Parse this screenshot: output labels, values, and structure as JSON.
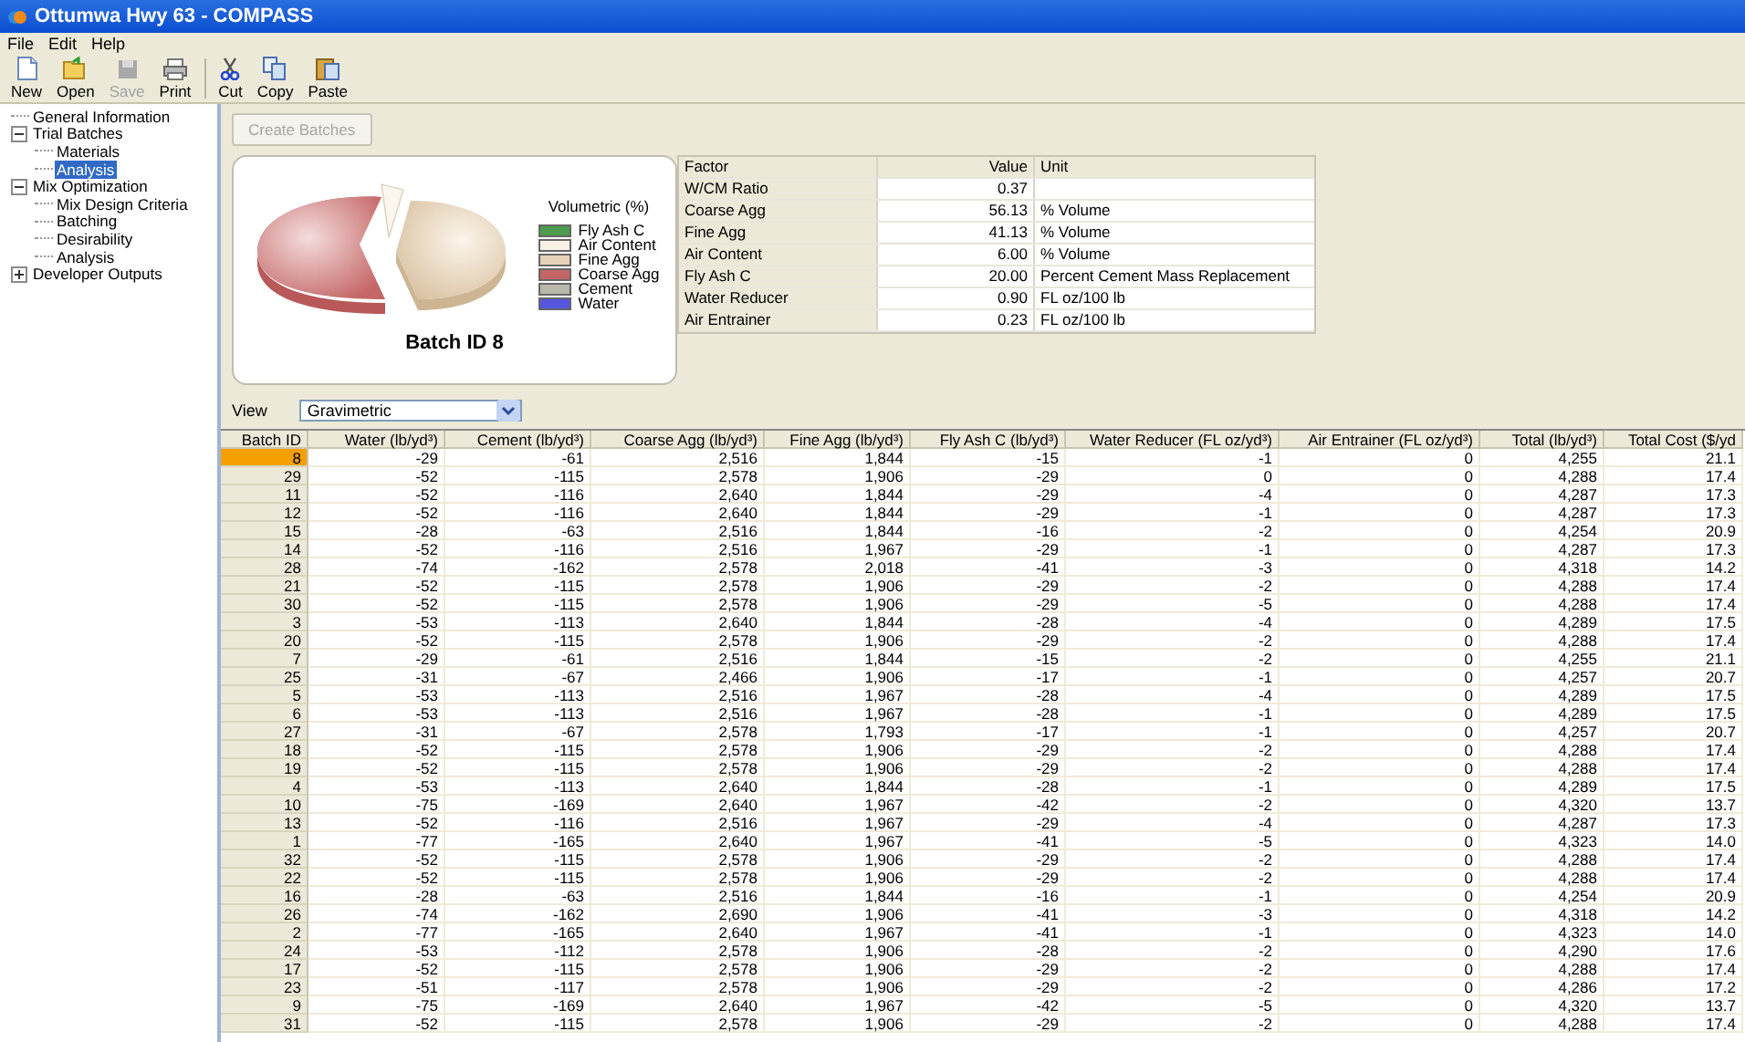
{
  "window": {
    "title": "Ottumwa Hwy 63 - COMPASS"
  },
  "menu": [
    "File",
    "Edit",
    "Help"
  ],
  "toolbar": [
    {
      "label": "New",
      "kind": "new",
      "disabled": false
    },
    {
      "label": "Open",
      "kind": "open",
      "disabled": false
    },
    {
      "label": "Save",
      "kind": "save",
      "disabled": true
    },
    {
      "label": "Print",
      "kind": "print",
      "disabled": false
    },
    {
      "label": "Cut",
      "kind": "cut",
      "disabled": false,
      "group_start": true
    },
    {
      "label": "Copy",
      "kind": "copy",
      "disabled": false
    },
    {
      "label": "Paste",
      "kind": "paste",
      "disabled": false
    }
  ],
  "sidebar": {
    "items": [
      {
        "label": "General Information",
        "selected": false
      },
      {
        "label": "Trial Batches",
        "selected": false,
        "expanded": true,
        "children": [
          {
            "label": "Materials",
            "selected": false
          },
          {
            "label": "Analysis",
            "selected": true
          }
        ]
      },
      {
        "label": "Mix Optimization",
        "selected": false,
        "expanded": true,
        "children": [
          {
            "label": "Mix Design Criteria",
            "selected": false
          },
          {
            "label": "Batching",
            "selected": false
          },
          {
            "label": "Desirability",
            "selected": false
          },
          {
            "label": "Analysis",
            "selected": false
          }
        ]
      },
      {
        "label": "Developer Outputs",
        "selected": false,
        "expanded": false
      }
    ]
  },
  "create_button": {
    "label": "Create Batches",
    "disabled": true
  },
  "chart_card": {
    "legend_title": "Volumetric (%)",
    "caption": "Batch ID 8",
    "legend": [
      {
        "label": "Fly Ash C",
        "color": "#4e9a4e"
      },
      {
        "label": "Air Content",
        "color": "#f8f2e6"
      },
      {
        "label": "Fine Agg",
        "color": "#e6d2b6"
      },
      {
        "label": "Coarse Agg",
        "color": "#c46666"
      },
      {
        "label": "Cement",
        "color": "#bab6aa"
      },
      {
        "label": "Water",
        "color": "#5656dd"
      }
    ]
  },
  "factors": {
    "columns": [
      "Factor",
      "Value",
      "Unit"
    ],
    "rows": [
      {
        "factor": "W/CM Ratio",
        "value": "0.37"
      },
      {
        "factor": "Coarse Agg",
        "value": "56.13",
        "unit": "% Volume"
      },
      {
        "factor": "Fine Agg",
        "value": "41.13",
        "unit": "% Volume"
      },
      {
        "factor": "Air Content",
        "value": "6.00",
        "unit": "% Volume"
      },
      {
        "factor": "Fly Ash C",
        "value": "20.00",
        "unit": "Percent Cement Mass Replacement"
      },
      {
        "factor": "Water Reducer",
        "value": "0.90",
        "unit": "FL oz/100 lb"
      },
      {
        "factor": "Air Entrainer",
        "value": "0.23",
        "unit": "FL oz/100 lb"
      }
    ]
  },
  "view": {
    "label": "View",
    "value": "Gravimetric"
  },
  "grid": {
    "columns": [
      "Batch ID",
      "Water (lb/yd³)",
      "Cement (lb/yd³)",
      "Coarse Agg (lb/yd³)",
      "Fine Agg (lb/yd³)",
      "Fly Ash C (lb/yd³)",
      "Water Reducer (FL oz/yd³)",
      "Air Entrainer (FL oz/yd³)",
      "Total (lb/yd³)",
      "Total Cost ($/yd"
    ],
    "rows": [
      {
        "selected": true,
        "cells": [
          "8",
          "-29",
          "-61",
          "2,516",
          "1,844",
          "-15",
          "-1",
          "0",
          "4,255",
          "21.1"
        ]
      },
      {
        "selected": false,
        "cells": [
          "29",
          "-52",
          "-115",
          "2,578",
          "1,906",
          "-29",
          "0",
          "0",
          "4,288",
          "17.4"
        ]
      },
      {
        "selected": false,
        "cells": [
          "11",
          "-52",
          "-116",
          "2,640",
          "1,844",
          "-29",
          "-4",
          "0",
          "4,287",
          "17.3"
        ]
      },
      {
        "selected": false,
        "cells": [
          "12",
          "-52",
          "-116",
          "2,640",
          "1,844",
          "-29",
          "-1",
          "0",
          "4,287",
          "17.3"
        ]
      },
      {
        "selected": false,
        "cells": [
          "15",
          "-28",
          "-63",
          "2,516",
          "1,844",
          "-16",
          "-2",
          "0",
          "4,254",
          "20.9"
        ]
      },
      {
        "selected": false,
        "cells": [
          "14",
          "-52",
          "-116",
          "2,516",
          "1,967",
          "-29",
          "-1",
          "0",
          "4,287",
          "17.3"
        ]
      },
      {
        "selected": false,
        "cells": [
          "28",
          "-74",
          "-162",
          "2,578",
          "2,018",
          "-41",
          "-3",
          "0",
          "4,318",
          "14.2"
        ]
      },
      {
        "selected": false,
        "cells": [
          "21",
          "-52",
          "-115",
          "2,578",
          "1,906",
          "-29",
          "-2",
          "0",
          "4,288",
          "17.4"
        ]
      },
      {
        "selected": false,
        "cells": [
          "30",
          "-52",
          "-115",
          "2,578",
          "1,906",
          "-29",
          "-5",
          "0",
          "4,288",
          "17.4"
        ]
      },
      {
        "selected": false,
        "cells": [
          "3",
          "-53",
          "-113",
          "2,640",
          "1,844",
          "-28",
          "-4",
          "0",
          "4,289",
          "17.5"
        ]
      },
      {
        "selected": false,
        "cells": [
          "20",
          "-52",
          "-115",
          "2,578",
          "1,906",
          "-29",
          "-2",
          "0",
          "4,288",
          "17.4"
        ]
      },
      {
        "selected": false,
        "cells": [
          "7",
          "-29",
          "-61",
          "2,516",
          "1,844",
          "-15",
          "-2",
          "0",
          "4,255",
          "21.1"
        ]
      },
      {
        "selected": false,
        "cells": [
          "25",
          "-31",
          "-67",
          "2,466",
          "1,906",
          "-17",
          "-1",
          "0",
          "4,257",
          "20.7"
        ]
      },
      {
        "selected": false,
        "cells": [
          "5",
          "-53",
          "-113",
          "2,516",
          "1,967",
          "-28",
          "-4",
          "0",
          "4,289",
          "17.5"
        ]
      },
      {
        "selected": false,
        "cells": [
          "6",
          "-53",
          "-113",
          "2,516",
          "1,967",
          "-28",
          "-1",
          "0",
          "4,289",
          "17.5"
        ]
      },
      {
        "selected": false,
        "cells": [
          "27",
          "-31",
          "-67",
          "2,578",
          "1,793",
          "-17",
          "-1",
          "0",
          "4,257",
          "20.7"
        ]
      },
      {
        "selected": false,
        "cells": [
          "18",
          "-52",
          "-115",
          "2,578",
          "1,906",
          "-29",
          "-2",
          "0",
          "4,288",
          "17.4"
        ]
      },
      {
        "selected": false,
        "cells": [
          "19",
          "-52",
          "-115",
          "2,578",
          "1,906",
          "-29",
          "-2",
          "0",
          "4,288",
          "17.4"
        ]
      },
      {
        "selected": false,
        "cells": [
          "4",
          "-53",
          "-113",
          "2,640",
          "1,844",
          "-28",
          "-1",
          "0",
          "4,289",
          "17.5"
        ]
      },
      {
        "selected": false,
        "cells": [
          "10",
          "-75",
          "-169",
          "2,640",
          "1,967",
          "-42",
          "-2",
          "0",
          "4,320",
          "13.7"
        ]
      },
      {
        "selected": false,
        "cells": [
          "13",
          "-52",
          "-116",
          "2,516",
          "1,967",
          "-29",
          "-4",
          "0",
          "4,287",
          "17.3"
        ]
      },
      {
        "selected": false,
        "cells": [
          "1",
          "-77",
          "-165",
          "2,640",
          "1,967",
          "-41",
          "-5",
          "0",
          "4,323",
          "14.0"
        ]
      },
      {
        "selected": false,
        "cells": [
          "32",
          "-52",
          "-115",
          "2,578",
          "1,906",
          "-29",
          "-2",
          "0",
          "4,288",
          "17.4"
        ]
      },
      {
        "selected": false,
        "cells": [
          "22",
          "-52",
          "-115",
          "2,578",
          "1,906",
          "-29",
          "-2",
          "0",
          "4,288",
          "17.4"
        ]
      },
      {
        "selected": false,
        "cells": [
          "16",
          "-28",
          "-63",
          "2,516",
          "1,844",
          "-16",
          "-1",
          "0",
          "4,254",
          "20.9"
        ]
      },
      {
        "selected": false,
        "cells": [
          "26",
          "-74",
          "-162",
          "2,690",
          "1,906",
          "-41",
          "-3",
          "0",
          "4,318",
          "14.2"
        ]
      },
      {
        "selected": false,
        "cells": [
          "2",
          "-77",
          "-165",
          "2,640",
          "1,967",
          "-41",
          "-1",
          "0",
          "4,323",
          "14.0"
        ]
      },
      {
        "selected": false,
        "cells": [
          "24",
          "-53",
          "-112",
          "2,578",
          "1,906",
          "-28",
          "-2",
          "0",
          "4,290",
          "17.6"
        ]
      },
      {
        "selected": false,
        "cells": [
          "17",
          "-52",
          "-115",
          "2,578",
          "1,906",
          "-29",
          "-2",
          "0",
          "4,288",
          "17.4"
        ]
      },
      {
        "selected": false,
        "cells": [
          "23",
          "-51",
          "-117",
          "2,578",
          "1,906",
          "-29",
          "-2",
          "0",
          "4,286",
          "17.2"
        ]
      },
      {
        "selected": false,
        "cells": [
          "9",
          "-75",
          "-169",
          "2,640",
          "1,967",
          "-42",
          "-5",
          "0",
          "4,320",
          "13.7"
        ]
      },
      {
        "selected": false,
        "cells": [
          "31",
          "-52",
          "-115",
          "2,578",
          "1,906",
          "-29",
          "-2",
          "0",
          "4,288",
          "17.4"
        ]
      }
    ]
  }
}
